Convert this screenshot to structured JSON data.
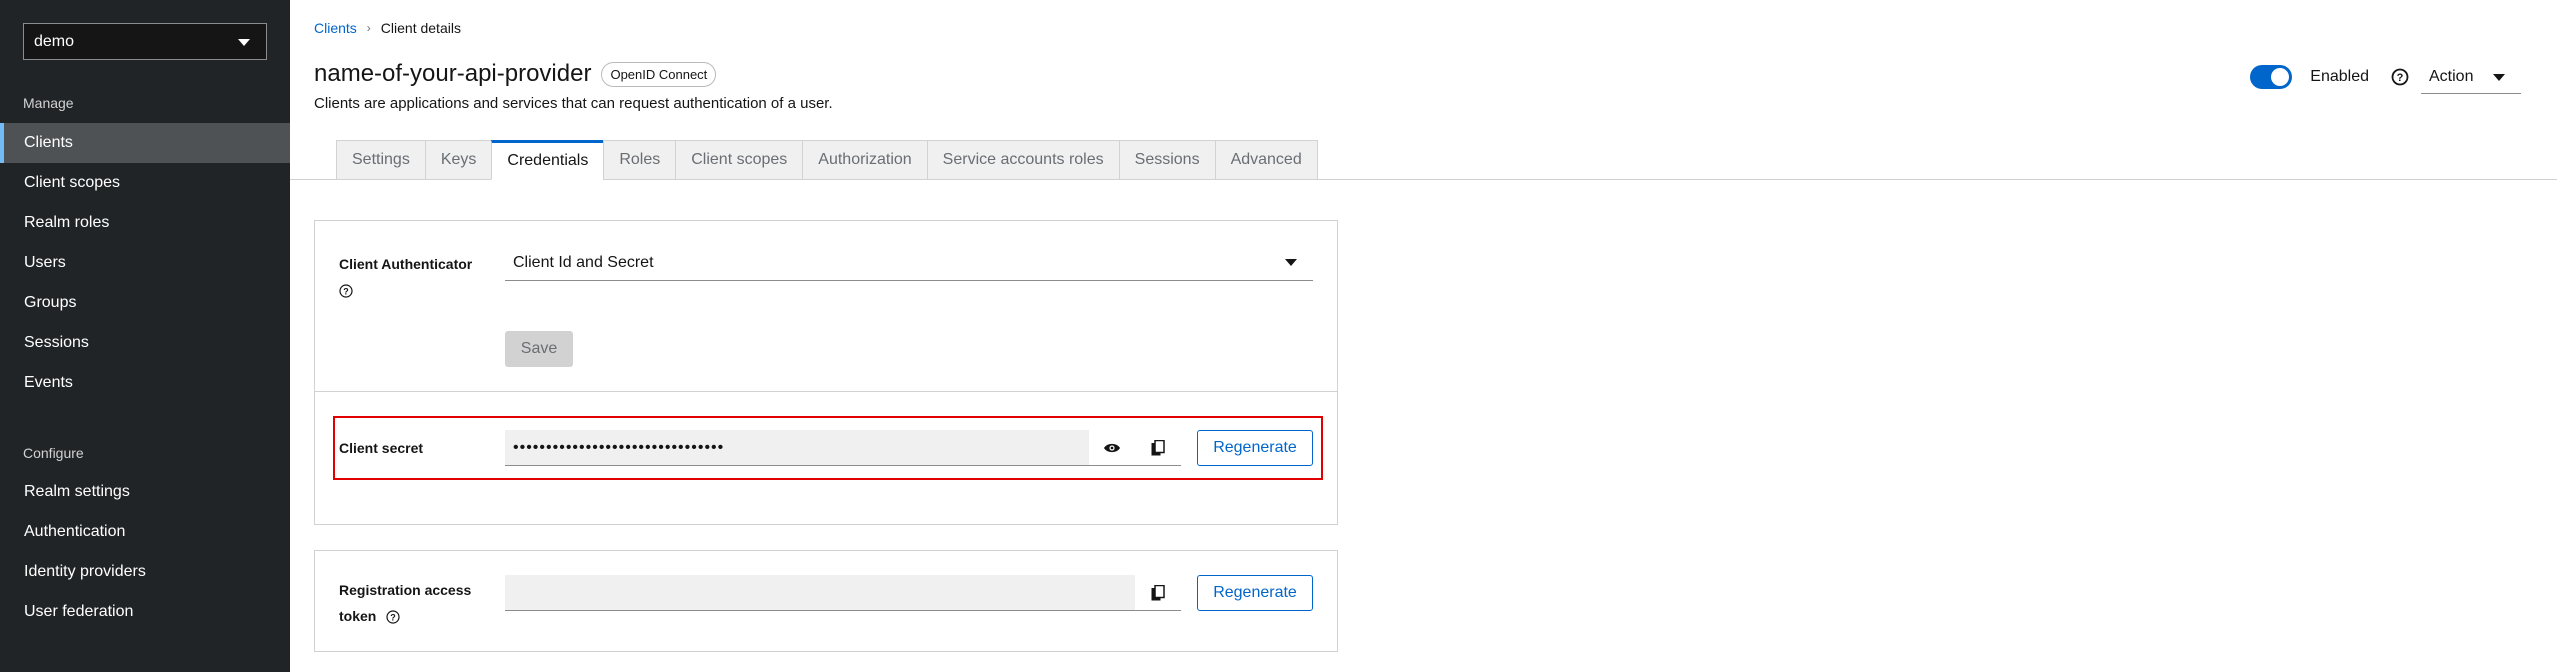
{
  "sidebar": {
    "realm": "demo",
    "sections": [
      {
        "title": "Manage",
        "items": [
          "Clients",
          "Client scopes",
          "Realm roles",
          "Users",
          "Groups",
          "Sessions",
          "Events"
        ]
      },
      {
        "title": "Configure",
        "items": [
          "Realm settings",
          "Authentication",
          "Identity providers",
          "User federation"
        ]
      }
    ],
    "active_item": "Clients"
  },
  "breadcrumb": {
    "parent": "Clients",
    "current": "Client details"
  },
  "header": {
    "title": "name-of-your-api-provider",
    "badge": "OpenID Connect",
    "description": "Clients are applications and services that can request authentication of a user.",
    "enabled_label": "Enabled",
    "action_label": "Action"
  },
  "tabs": [
    "Settings",
    "Keys",
    "Credentials",
    "Roles",
    "Client scopes",
    "Authorization",
    "Service accounts roles",
    "Sessions",
    "Advanced"
  ],
  "active_tab": "Credentials",
  "credentials": {
    "authenticator_label": "Client Authenticator",
    "authenticator_value": "Client Id and Secret",
    "save_label": "Save",
    "secret_label": "Client secret",
    "secret_value": "••••••••••••••••••••••••••••••••",
    "regenerate_label": "Regenerate",
    "registration_label_line1": "Registration access",
    "registration_label_line2": "token",
    "registration_value": "",
    "regenerate_label2": "Regenerate"
  },
  "colors": {
    "accent": "#0066cc",
    "highlight": "#e00000",
    "sidebar_bg": "#212427"
  }
}
